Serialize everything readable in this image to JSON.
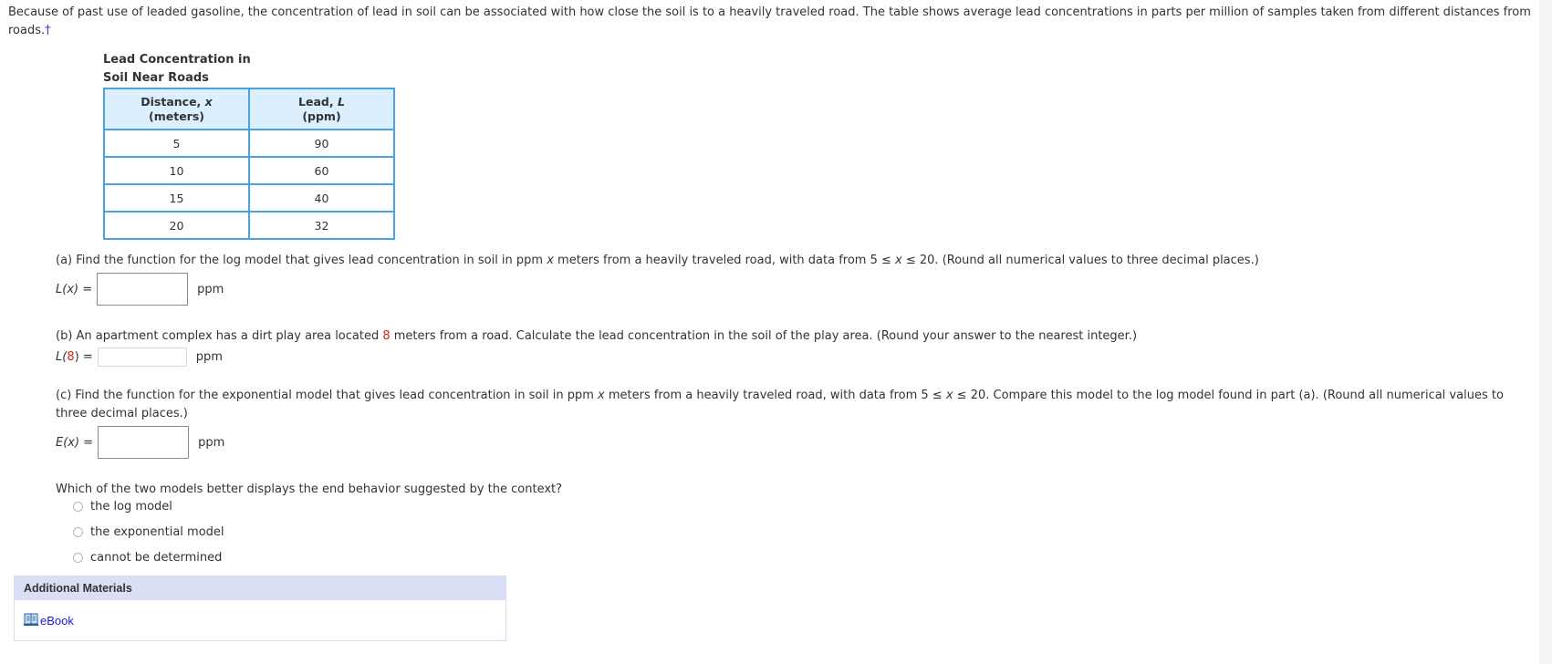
{
  "intro": {
    "text": "Because of past use of leaded gasoline, the concentration of lead in soil can be associated with how close the soil is to a heavily traveled road. The table shows average lead concentrations in parts per million of samples taken from different distances from roads.",
    "footnote_marker": "†"
  },
  "table": {
    "caption_line1": "Lead Concentration in",
    "caption_line2": "Soil Near Roads",
    "headers": [
      {
        "label": "Distance, ",
        "var": "x",
        "unit": "(meters)"
      },
      {
        "label": "Lead, ",
        "var": "L",
        "unit": "(ppm)"
      }
    ],
    "rows": [
      [
        "5",
        "90"
      ],
      [
        "10",
        "60"
      ],
      [
        "15",
        "40"
      ],
      [
        "20",
        "32"
      ]
    ]
  },
  "part_a": {
    "prompt_prefix": "(a) Find the function for the log model that gives lead concentration in soil in ppm ",
    "prompt_var": "x",
    "prompt_mid": " meters from a heavily traveled road, with data from  5 ≤ ",
    "prompt_var2": "x",
    "prompt_suffix": " ≤ 20.  (Round all numerical values to three decimal places.)",
    "label": "L(x) =",
    "value": "",
    "unit": "ppm"
  },
  "part_b": {
    "prompt_prefix": "(b) An apartment complex has a dirt play area located ",
    "highlight": "8",
    "prompt_suffix": " meters from a road. Calculate the lead concentration in the soil of the play area. (Round your answer to the nearest integer.)",
    "label_prefix": "L(",
    "label_value": "8",
    "label_suffix": ") =",
    "value": "",
    "unit": "ppm"
  },
  "part_c": {
    "prompt_line1_prefix": "(c) Find the function for the exponential model that gives lead concentration in soil in ppm ",
    "prompt_var": "x",
    "prompt_line1_mid": " meters from a heavily traveled road, with data from  5 ≤ ",
    "prompt_var2": "x",
    "prompt_line1_suffix": " ≤ 20.  Compare this model to the log model found in part (a). (Round all numerical values to",
    "prompt_line2": "three decimal places.)",
    "label": "E(x) =",
    "value": "",
    "unit": "ppm"
  },
  "question": {
    "text": "Which of the two models better displays the end behavior suggested by the context?",
    "options": [
      "the log model",
      "the exponential model",
      "cannot be determined"
    ],
    "selected": null
  },
  "materials": {
    "header": "Additional Materials",
    "ebook_label": "eBook",
    "ebook_icon": "open-book-icon"
  }
}
